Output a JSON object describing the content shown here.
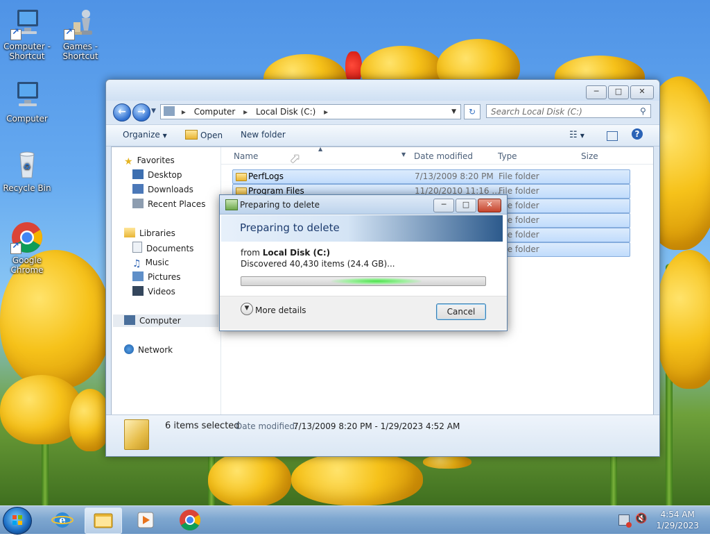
{
  "desktop": {
    "icons": [
      {
        "label": "Computer - Shortcut",
        "icon": "computer-icon"
      },
      {
        "label": "Games - Shortcut",
        "icon": "games-chess-icon"
      },
      {
        "label": "Computer",
        "icon": "computer-icon"
      },
      {
        "label": "Recycle Bin",
        "icon": "recycle-bin-icon"
      },
      {
        "label": "Google Chrome",
        "icon": "chrome-icon"
      }
    ]
  },
  "explorer": {
    "breadcrumb": [
      "Computer",
      "Local Disk (C:)"
    ],
    "search_placeholder": "Search Local Disk (C:)",
    "toolbar": {
      "organize": "Organize",
      "open": "Open",
      "new_folder": "New folder"
    },
    "nav": {
      "favorites": "Favorites",
      "favorites_items": [
        "Desktop",
        "Downloads",
        "Recent Places"
      ],
      "libraries": "Libraries",
      "libraries_items": [
        "Documents",
        "Music",
        "Pictures",
        "Videos"
      ],
      "computer": "Computer",
      "network": "Network"
    },
    "columns": {
      "name": "Name",
      "date": "Date modified",
      "type": "Type",
      "size": "Size"
    },
    "files": [
      {
        "name": "PerfLogs",
        "date": "7/13/2009 8:20 PM",
        "type": "File folder"
      },
      {
        "name": "Program Files",
        "date": "11/20/2010 11:16 ...",
        "type": "File folder"
      },
      {
        "name": "",
        "date": "",
        "type": "File folder"
      },
      {
        "name": "",
        "date": "",
        "type": "File folder"
      },
      {
        "name": "",
        "date": "",
        "type": "File folder"
      },
      {
        "name": "",
        "date": "",
        "type": "File folder"
      }
    ],
    "status": {
      "count": "6 items selected",
      "date_label": "Date modified:",
      "date_value": "7/13/2009 8:20 PM - 1/29/2023 4:52 AM"
    }
  },
  "dialog": {
    "title": "Preparing to delete",
    "heading": "Preparing to delete",
    "from_prefix": "from",
    "from_location": "Local Disk (C:)",
    "discovered": "Discovered 40,430 items (24.4 GB)...",
    "more_details": "More details",
    "cancel": "Cancel"
  },
  "taskbar": {
    "time": "4:54 AM",
    "date": "1/29/2023",
    "pinned": [
      "internet-explorer-icon",
      "windows-explorer-icon",
      "media-player-icon",
      "chrome-icon"
    ]
  }
}
